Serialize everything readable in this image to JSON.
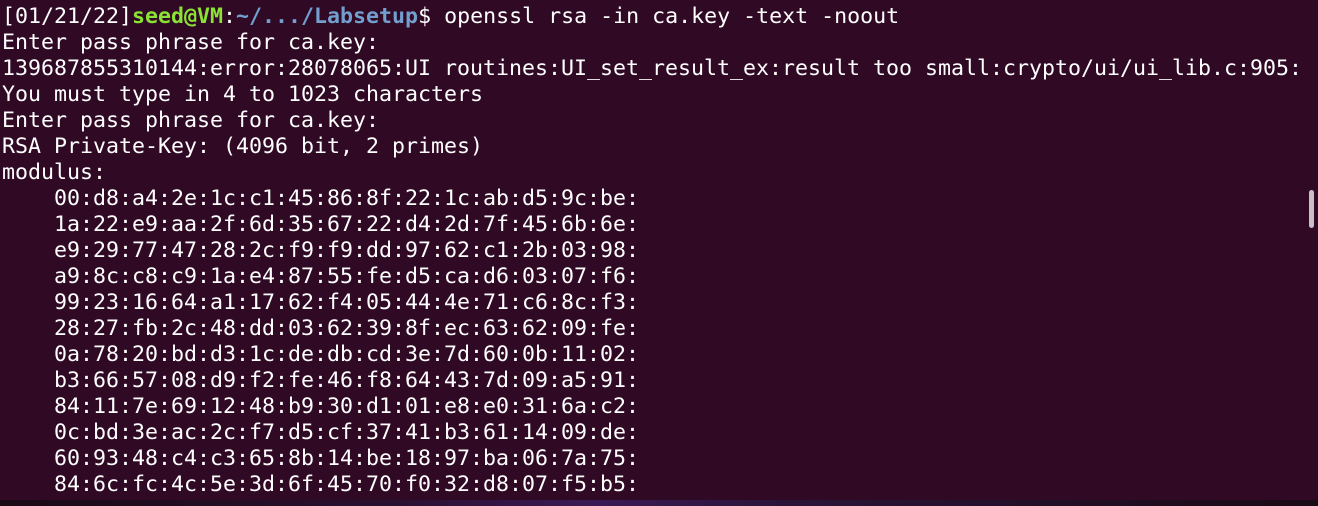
{
  "terminal": {
    "prompt": {
      "date": "[01/21/22]",
      "user_host": "seed@VM",
      "colon": ":",
      "path": "~/.../Labsetup",
      "dollar": "$",
      "command": " openssl rsa -in ca.key -text -noout"
    },
    "output": [
      "Enter pass phrase for ca.key:",
      "139687855310144:error:28078065:UI routines:UI_set_result_ex:result too small:crypto/ui/ui_lib.c:905:",
      "You must type in 4 to 1023 characters",
      "Enter pass phrase for ca.key:",
      "RSA Private-Key: (4096 bit, 2 primes)",
      "modulus:"
    ],
    "modulus_lines": [
      "00:d8:a4:2e:1c:c1:45:86:8f:22:1c:ab:d5:9c:be:",
      "1a:22:e9:aa:2f:6d:35:67:22:d4:2d:7f:45:6b:6e:",
      "e9:29:77:47:28:2c:f9:f9:dd:97:62:c1:2b:03:98:",
      "a9:8c:c8:c9:1a:e4:87:55:fe:d5:ca:d6:03:07:f6:",
      "99:23:16:64:a1:17:62:f4:05:44:4e:71:c6:8c:f3:",
      "28:27:fb:2c:48:dd:03:62:39:8f:ec:63:62:09:fe:",
      "0a:78:20:bd:d3:1c:de:db:cd:3e:7d:60:0b:11:02:",
      "b3:66:57:08:d9:f2:fe:46:f8:64:43:7d:09:a5:91:",
      "84:11:7e:69:12:48:b9:30:d1:01:e8:e0:31:6a:c2:",
      "0c:bd:3e:ac:2c:f7:d5:cf:37:41:b3:61:14:09:de:",
      "60:93:48:c4:c3:65:8b:14:be:18:97:ba:06:7a:75:",
      "84:6c:fc:4c:5e:3d:6f:45:70:f0:32:d8:07:f5:b5:"
    ]
  },
  "colors": {
    "background": "#300a24",
    "text": "#ffffff",
    "user": "#8ae234",
    "path": "#729fcf"
  }
}
